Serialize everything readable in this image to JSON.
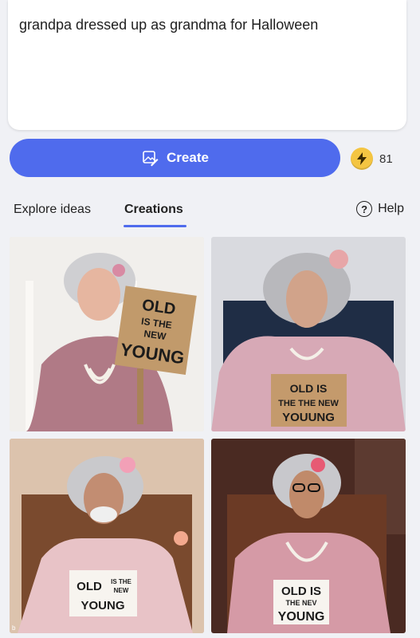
{
  "prompt": {
    "text": "grandpa dressed up as grandma for Halloween"
  },
  "create_button": {
    "label": "Create",
    "icon": "image-create-icon",
    "color": "#4f6bed"
  },
  "boosts": {
    "icon": "lightning-coin-icon",
    "count": "81"
  },
  "tabs": [
    {
      "label": "Explore ideas",
      "active": false
    },
    {
      "label": "Creations",
      "active": true
    }
  ],
  "help": {
    "label": "Help",
    "icon": "question-circle-icon"
  },
  "images": [
    {
      "sign_lines": [
        "OLD",
        "IS THE",
        "NEW",
        "YOUNG"
      ]
    },
    {
      "sign_lines": [
        "OLD IS",
        "THE THE NEW",
        "YOUUNG"
      ]
    },
    {
      "sign_lines": [
        "OLD",
        "IS THE",
        "NEW",
        "YOUNG"
      ]
    },
    {
      "sign_lines": [
        "OLD IS",
        "THE NEV",
        "YOUNG"
      ]
    }
  ],
  "watermark": "b"
}
